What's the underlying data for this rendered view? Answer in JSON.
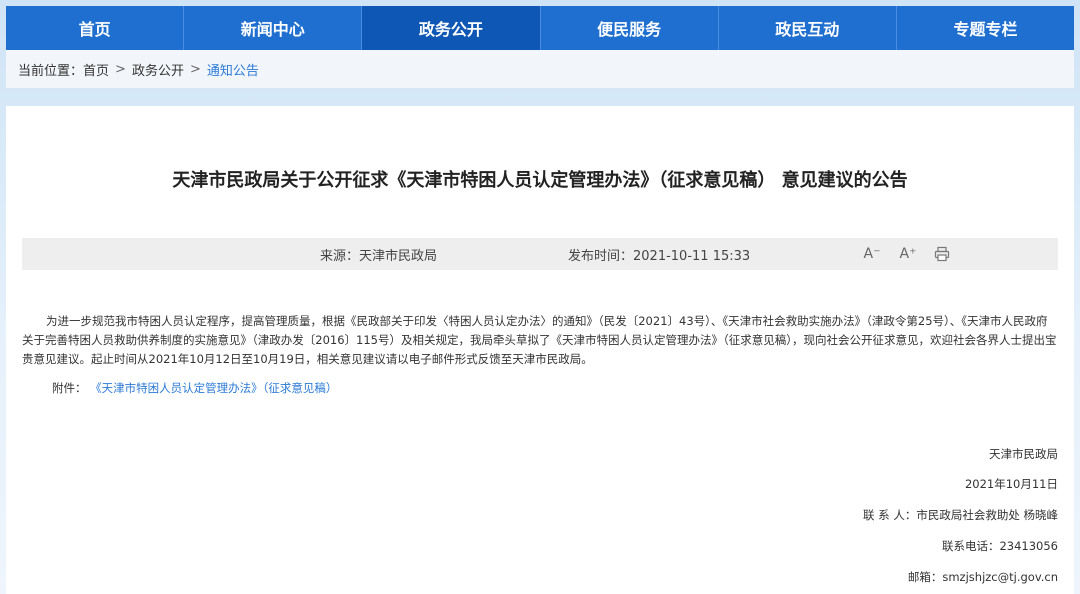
{
  "nav": {
    "items": [
      "首页",
      "新闻中心",
      "政务公开",
      "便民服务",
      "政民互动",
      "专题专栏"
    ],
    "active_index": 2
  },
  "breadcrumb": {
    "prefix": "当前位置：",
    "items": [
      "首页",
      "政务公开",
      "通知公告"
    ],
    "separator": ">"
  },
  "article": {
    "title": "天津市民政局关于公开征求《天津市特困人员认定管理办法》（征求意见稿） 意见建议的公告",
    "source_label": "来源：",
    "source": "天津市民政局",
    "date_label": "发布时间：",
    "date": "2021-10-11 15:33",
    "tools": {
      "font_smaller": "A⁻",
      "font_larger": "A⁺",
      "print_icon": "printer-icon"
    },
    "body": "为进一步规范我市特困人员认定程序，提高管理质量，根据《民政部关于印发〈特困人员认定办法〉的通知》（民发〔2021〕43号）、《天津市社会救助实施办法》（津政令第25号）、《天津市人民政府关于完善特困人员救助供养制度的实施意见》（津政办发〔2016〕115号）及相关规定，我局牵头草拟了《天津市特困人员认定管理办法》（征求意见稿），现向社会公开征求意见，欢迎社会各界人士提出宝贵意见建议。起止时间从2021年10月12日至10月19日，相关意见建议请以电子邮件形式反馈至天津市民政局。",
    "attachment_label": "附件：",
    "attachment_link": "《天津市特困人员认定管理办法》（征求意见稿）",
    "signature": {
      "org": "天津市民政局",
      "date": "2021年10月11日",
      "contact": "联 系 人：市民政局社会救助处   杨晓峰",
      "phone": "联系电话：23413056",
      "email": "邮箱：smzjshjzc@tj.gov.cn"
    }
  },
  "colors": {
    "nav_bg": "#1e6fd0",
    "nav_active": "#0e57b5",
    "link": "#2c7ad6"
  }
}
